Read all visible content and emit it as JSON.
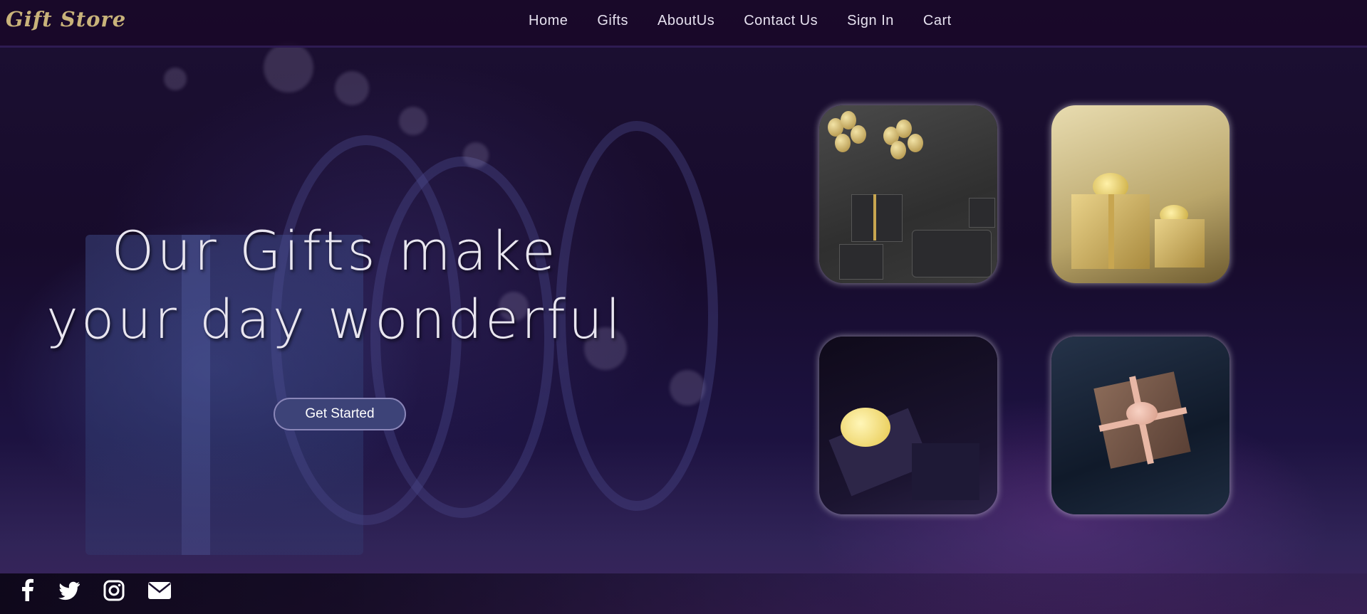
{
  "brand": {
    "logo_text": "Gift Store"
  },
  "nav": {
    "items": [
      {
        "label": "Home"
      },
      {
        "label": "Gifts"
      },
      {
        "label": "AboutUs"
      },
      {
        "label": "Contact Us"
      },
      {
        "label": "Sign In"
      },
      {
        "label": "Cart"
      }
    ]
  },
  "hero": {
    "headline_line1": "Our Gifts make",
    "headline_line2": "your day wonderful",
    "cta_label": "Get Started"
  },
  "gallery": {
    "tiles": [
      {
        "image": "gold-balloons-and-black-gift-boxes"
      },
      {
        "image": "gold-wrapped-gift-boxes-bokeh"
      },
      {
        "image": "open-dark-box-with-yellow-bow"
      },
      {
        "image": "brown-box-with-pink-ribbon-on-satin"
      }
    ]
  },
  "social": {
    "icons": [
      "facebook-icon",
      "twitter-icon",
      "instagram-icon",
      "envelope-icon"
    ]
  },
  "colors": {
    "logo": "#c9b37a",
    "nav_bg": "#19082a",
    "cta_bg": "#3d4378",
    "text": "#e9e6f0"
  }
}
